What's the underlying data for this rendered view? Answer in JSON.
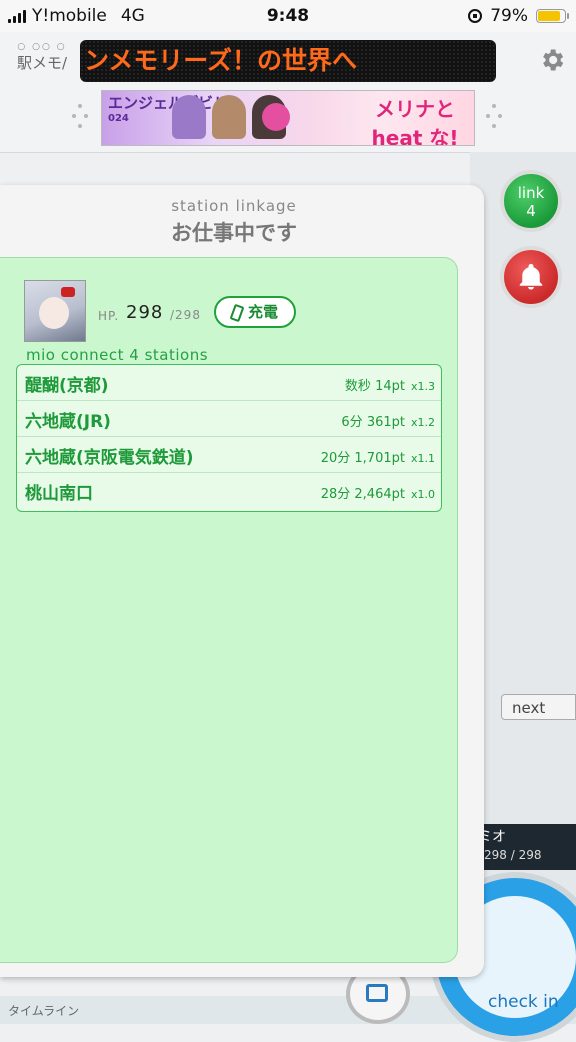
{
  "status_bar": {
    "carrier": "Y!mobile",
    "network": "4G",
    "time": "9:48",
    "battery": "79%",
    "battery_level": 0.79
  },
  "header": {
    "logo": "駅メモ/",
    "marquee": "ンメモリーズ！の世界へ",
    "banner": {
      "left_text": "エンジェルデビル",
      "left_small": "024",
      "right_line1": "メリナと",
      "right_line2": "heat な!"
    }
  },
  "panel": {
    "subtitle": "station linkage",
    "title": "お仕事中です",
    "character": {
      "hp_label": "HP.",
      "hp": "298",
      "hp_max": "/298",
      "charge_label": "充電"
    },
    "connect_label": "mio connect 4 stations",
    "stations": [
      {
        "name": "醍醐(京都)",
        "time": "数秒",
        "points": "14pt",
        "multiplier": "x1.3"
      },
      {
        "name": "六地蔵(JR)",
        "time": "6分",
        "points": "361pt",
        "multiplier": "x1.2"
      },
      {
        "name": "六地蔵(京阪電気鉄道)",
        "time": "20分",
        "points": "1,701pt",
        "multiplier": "x1.1"
      },
      {
        "name": "桃山南口",
        "time": "28分",
        "points": "2,464pt",
        "multiplier": "x1.0"
      }
    ]
  },
  "right_panel": {
    "link_label": "link",
    "link_count": "4",
    "next_label": "next",
    "char_name": "ミオ",
    "char_hp": "298 / 298",
    "checkin_label": "check in"
  },
  "bottom": {
    "timeline_label": "タイムライン"
  }
}
